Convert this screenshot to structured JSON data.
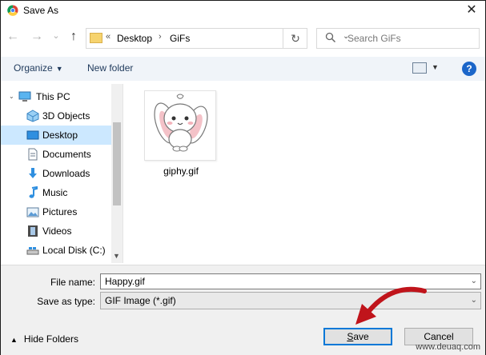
{
  "window": {
    "title": "Save As",
    "close_glyph": "✕"
  },
  "nav": {
    "back_glyph": "←",
    "forward_glyph": "→",
    "recent_glyph": "⌄",
    "up_glyph": "↑",
    "address": {
      "overflow": "«",
      "crumbs": [
        "Desktop",
        "GiFs"
      ],
      "separator": "›",
      "dropdown_glyph": "⌄"
    },
    "refresh_glyph": "↻",
    "search_placeholder": "Search GiFs"
  },
  "toolbar": {
    "organize_label": "Organize",
    "new_folder_label": "New folder",
    "help_glyph": "?"
  },
  "sidebar": {
    "items": [
      {
        "label": "This PC",
        "icon": "computer-icon"
      },
      {
        "label": "3D Objects",
        "icon": "cube-icon"
      },
      {
        "label": "Desktop",
        "icon": "desktop-icon"
      },
      {
        "label": "Documents",
        "icon": "document-icon"
      },
      {
        "label": "Downloads",
        "icon": "download-icon"
      },
      {
        "label": "Music",
        "icon": "music-icon"
      },
      {
        "label": "Pictures",
        "icon": "pictures-icon"
      },
      {
        "label": "Videos",
        "icon": "video-icon"
      },
      {
        "label": "Local Disk (C:)",
        "icon": "drive-icon"
      }
    ],
    "selected": "Desktop"
  },
  "content": {
    "files": [
      {
        "name": "giphy.gif",
        "icon": "bunny-thumbnail"
      }
    ]
  },
  "form": {
    "file_name_label": "File name:",
    "file_name_value": "Happy.gif",
    "save_type_label": "Save as type:",
    "save_type_value": "GIF Image (*.gif)"
  },
  "footer": {
    "hide_folders_label": "Hide Folders",
    "save_label_underlined": "S",
    "save_label_rest": "ave",
    "cancel_label": "Cancel",
    "watermark": "www.deuaq.com"
  },
  "colors": {
    "accent": "#0078d7",
    "selection": "#cce8ff",
    "toolbar_bg": "#f0f4f9",
    "annotation_arrow": "#c0141b"
  }
}
